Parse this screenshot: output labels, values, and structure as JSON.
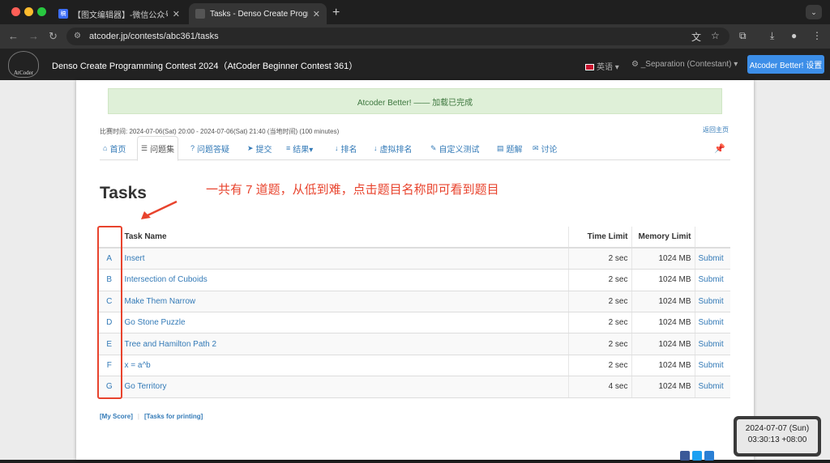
{
  "browser": {
    "tabs": [
      {
        "label": "【图文编辑器】-微信公众号图",
        "favicon": "稿"
      },
      {
        "label": "Tasks - Denso Create Program",
        "favicon": ""
      }
    ],
    "new_tab": "+",
    "url": "atcoder.jp/contests/abc361/tasks"
  },
  "site": {
    "logo_text": "AtCoder",
    "contest_title": "Denso Create Programming Contest 2024（AtCoder Beginner Contest 361）",
    "language": "英语 ▾",
    "user": "_Separation (Contestant) ▾",
    "atcoder_better_button": "Atcoder Better! 设置"
  },
  "alert": "Atcoder Better! —— 加载已完成",
  "contest_period": "比赛时间: 2024-07-06(Sat) 20:00 - 2024-07-06(Sat) 21:40 (当地时间) (100 minutes)",
  "back_home": "返回主页",
  "contest_tabs": [
    {
      "icon": "home-icon",
      "glyph": "⌂",
      "label": "首页"
    },
    {
      "icon": "list-icon",
      "glyph": "☰",
      "label": "问题集"
    },
    {
      "icon": "question-icon",
      "glyph": "?",
      "label": "问题答疑"
    },
    {
      "icon": "send-icon",
      "glyph": "➤",
      "label": "提交"
    },
    {
      "icon": "results-icon",
      "glyph": "≡",
      "label": "结果▾"
    },
    {
      "icon": "sort-icon",
      "glyph": "↓",
      "label": "排名"
    },
    {
      "icon": "virtual-sort-icon",
      "glyph": "↓",
      "label": "虚拟排名"
    },
    {
      "icon": "wrench-icon",
      "glyph": "✎",
      "label": "自定义测试"
    },
    {
      "icon": "book-icon",
      "glyph": "▤",
      "label": "题解"
    },
    {
      "icon": "comment-icon",
      "glyph": "✉",
      "label": "讨论"
    }
  ],
  "page_title": "Tasks",
  "annotation": "一共有 7 道题，从低到难，点击题目名称即可看到题目",
  "table": {
    "headers": [
      "",
      "Task Name",
      "Time Limit",
      "Memory Limit",
      ""
    ],
    "rows": [
      {
        "id": "A",
        "name": "Insert",
        "time": "2 sec",
        "memory": "1024 MB",
        "submit": "Submit"
      },
      {
        "id": "B",
        "name": "Intersection of Cuboids",
        "time": "2 sec",
        "memory": "1024 MB",
        "submit": "Submit"
      },
      {
        "id": "C",
        "name": "Make Them Narrow",
        "time": "2 sec",
        "memory": "1024 MB",
        "submit": "Submit"
      },
      {
        "id": "D",
        "name": "Go Stone Puzzle",
        "time": "2 sec",
        "memory": "1024 MB",
        "submit": "Submit"
      },
      {
        "id": "E",
        "name": "Tree and Hamilton Path 2",
        "time": "2 sec",
        "memory": "1024 MB",
        "submit": "Submit"
      },
      {
        "id": "F",
        "name": "x = a^b",
        "time": "2 sec",
        "memory": "1024 MB",
        "submit": "Submit"
      },
      {
        "id": "G",
        "name": "Go Territory",
        "time": "4 sec",
        "memory": "1024 MB",
        "submit": "Submit"
      }
    ]
  },
  "footer_links": {
    "my_score": "[My Score]",
    "tasks_printing": "[Tasks for printing]"
  },
  "clock": {
    "date": "2024-07-07 (Sun)",
    "time": "03:30:13 +08:00"
  },
  "colors": {
    "link": "#337ab7",
    "annotation": "#e8432d",
    "alert_bg": "#dff0d8",
    "navbar": "#222222"
  }
}
